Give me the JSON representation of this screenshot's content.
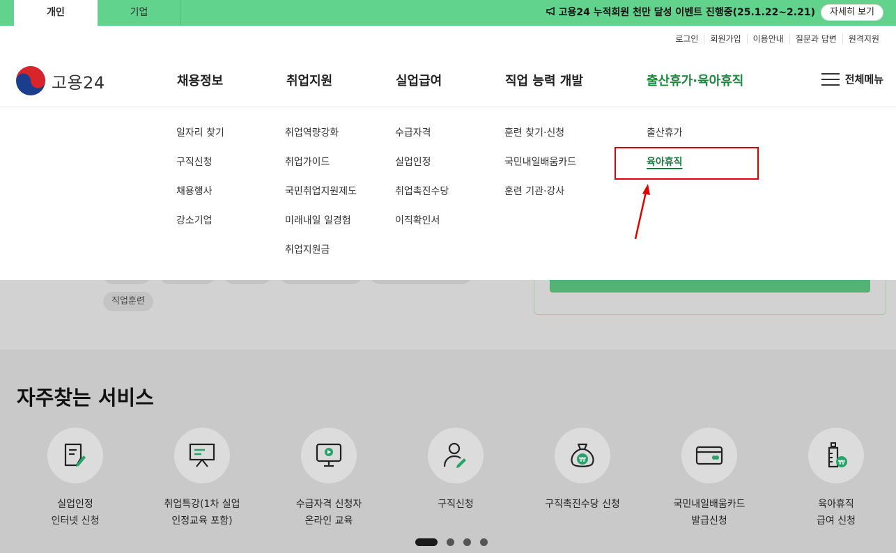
{
  "top_tabs": {
    "personal": "개인",
    "business": "기업"
  },
  "event_banner": {
    "icon": "megaphone-icon",
    "text": "고용24 누적회원 천만 달성 이벤트 진행중(25.1.22~2.21)",
    "detail_button": "자세히 보기"
  },
  "util_links": [
    "로그인",
    "회원가입",
    "이용안내",
    "질문과 답변",
    "원격지원"
  ],
  "logo": {
    "text": "고용24"
  },
  "gnb": [
    "채용정보",
    "취업지원",
    "실업급여",
    "직업 능력 개발",
    "출산휴가·육아휴직"
  ],
  "all_menu": "전체메뉴",
  "mega_menu": [
    [
      "일자리 찾기",
      "구직신청",
      "채용행사",
      "강소기업"
    ],
    [
      "취업역량강화",
      "취업가이드",
      "국민취업지원제도",
      "미래내일 일경험",
      "취업지원금"
    ],
    [
      "수급자격",
      "실업인정",
      "취업촉진수당",
      "이직확인서"
    ],
    [
      "훈련 찾기·신청",
      "국민내일배움카드",
      "훈련 기관·강사"
    ],
    [
      "출산휴가",
      "육아휴직"
    ]
  ],
  "background_chip": "직업훈련",
  "frequent_services": {
    "title": "자주찾는 서비스",
    "items": [
      {
        "line1": "실업인정",
        "line2": "인터넷 신청",
        "icon": "document-pen-icon"
      },
      {
        "line1": "취업특강(1차 실업",
        "line2": "인정교육 포함)",
        "icon": "presentation-board-icon"
      },
      {
        "line1": "수급자격 신청자",
        "line2": "온라인 교육",
        "icon": "monitor-play-icon"
      },
      {
        "line1": "구직신청",
        "line2": "",
        "icon": "person-pen-icon"
      },
      {
        "line1": "구직촉진수당 신청",
        "line2": "",
        "icon": "money-bag-icon"
      },
      {
        "line1": "국민내일배움카드",
        "line2": "발급신청",
        "icon": "card-icon"
      },
      {
        "line1": "육아휴직",
        "line2": "급여 신청",
        "icon": "baby-bottle-icon"
      }
    ]
  },
  "colors": {
    "top_bar": "#62d38c",
    "accent_green": "#1a8a3e",
    "highlight_red": "#e00000"
  }
}
